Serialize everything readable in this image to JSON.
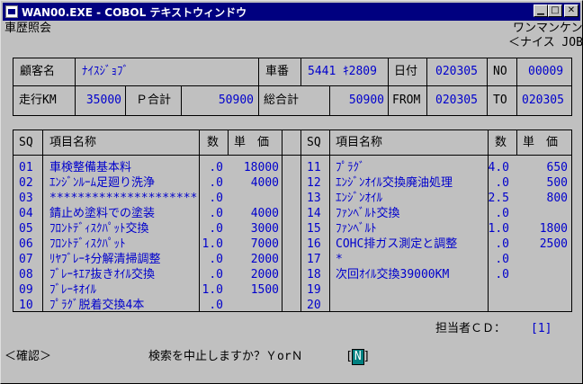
{
  "window": {
    "title": "WAN00.EXE - COBOL テキストウィンドウ"
  },
  "header": {
    "screen_name": "車歴照会",
    "company_line1": "ワンマンケン",
    "company_line2": "＜ナイス JOB＞"
  },
  "customer": {
    "name_label": "顧客名",
    "name_value": "ﾅｲｽｼﾞｮﾌﾞ",
    "car_no_label": "車番",
    "car_no_value": "5441 ｷ2809",
    "date_label": "日付",
    "date_value": "020305",
    "no_label": "NO",
    "no_value": "00009",
    "km_label": "走行KM",
    "km_value": "35000",
    "p_total_label": "Ｐ合計",
    "p_total_value": "50900",
    "total_label": "総合計",
    "total_value": "50900",
    "from_label": "FROM",
    "from_value": "020305",
    "to_label": "TO",
    "to_value": "020305"
  },
  "table": {
    "headers": {
      "sq": "SQ",
      "item": "項目名称",
      "qty": "数",
      "price": "単　価"
    },
    "left_rows": [
      {
        "sq": "01",
        "item": "車検整備基本料",
        "qty": ".0",
        "price": "18000"
      },
      {
        "sq": "02",
        "item": "ｴﾝｼﾞﾝﾙｰﾑ足廻り洗浄",
        "qty": ".0",
        "price": "4000"
      },
      {
        "sq": "03",
        "item": "*********************",
        "qty": ".0",
        "price": ""
      },
      {
        "sq": "04",
        "item": "錆止め塗料での塗装",
        "qty": ".0",
        "price": "4000"
      },
      {
        "sq": "05",
        "item": "ﾌﾛﾝﾄﾃﾞｨｽｸﾊﾟｯﾄ交換",
        "qty": ".0",
        "price": "3000"
      },
      {
        "sq": "06",
        "item": "ﾌﾛﾝﾄﾃﾞｨｽｸﾊﾟｯﾄ",
        "qty": "1.0",
        "price": "7000"
      },
      {
        "sq": "07",
        "item": "ﾘﾔﾌﾞﾚｰｷ分解清掃調整",
        "qty": ".0",
        "price": "2000"
      },
      {
        "sq": "08",
        "item": "ﾌﾞﾚｰｷｴｱ抜きｵｲﾙ交換",
        "qty": ".0",
        "price": "2000"
      },
      {
        "sq": "09",
        "item": "ﾌﾞﾚｰｷｵｲﾙ",
        "qty": "1.0",
        "price": "1500"
      },
      {
        "sq": "10",
        "item": "ﾌﾟﾗｸﾞ脱着交換4本",
        "qty": ".0",
        "price": ""
      }
    ],
    "right_rows": [
      {
        "sq": "11",
        "item": "ﾌﾟﾗｸﾞ",
        "qty": "4.0",
        "price": "650"
      },
      {
        "sq": "12",
        "item": "ｴﾝｼﾞﾝｵｲﾙ交換廃油処理",
        "qty": ".0",
        "price": "500"
      },
      {
        "sq": "13",
        "item": "ｴﾝｼﾞﾝｵｲﾙ",
        "qty": "2.5",
        "price": "800"
      },
      {
        "sq": "14",
        "item": "ﾌｧﾝﾍﾞﾙﾄ交換",
        "qty": ".0",
        "price": ""
      },
      {
        "sq": "15",
        "item": "ﾌｧﾝﾍﾞﾙﾄ",
        "qty": "1.0",
        "price": "1800"
      },
      {
        "sq": "16",
        "item": "COHC排ガス測定と調整",
        "qty": ".0",
        "price": "2500"
      },
      {
        "sq": "17",
        "item": "*",
        "qty": ".0",
        "price": ""
      },
      {
        "sq": "18",
        "item": "次回ｵｲﾙ交換39000KM",
        "qty": ".0",
        "price": ""
      },
      {
        "sq": "19",
        "item": "",
        "qty": "",
        "price": ""
      },
      {
        "sq": "20",
        "item": "",
        "qty": "",
        "price": ""
      }
    ]
  },
  "footer": {
    "staff_label": "担当者ＣＤ：",
    "staff_value": "[1]",
    "mode": "＜確認＞",
    "prompt": "検索を中止しますか？ＹorＮ",
    "answer_open": "[",
    "answer": "N",
    "answer_close": "]"
  }
}
